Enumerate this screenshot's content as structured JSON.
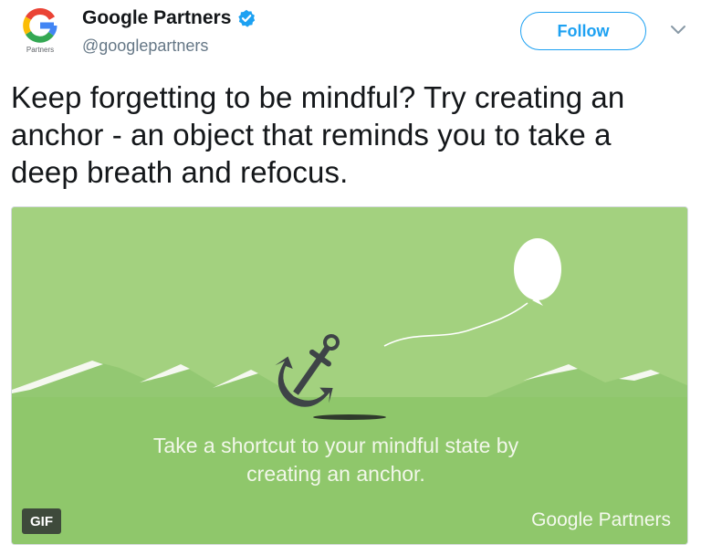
{
  "tweet": {
    "author": {
      "display_name": "Google Partners",
      "handle": "@googlepartners",
      "avatar_caption": "Partners",
      "verified_icon": "verified-badge-icon"
    },
    "follow_label": "Follow",
    "menu_icon": "chevron-down-icon",
    "text": "Keep forgetting to be mindful? Try creating an anchor - an object that reminds you to take a deep breath and refocus."
  },
  "media": {
    "type": "gif",
    "badge_label": "GIF",
    "caption": "Take a shortcut to your mindful state by creating an anchor.",
    "watermark": "Google Partners",
    "icons": [
      "balloon-icon",
      "anchor-icon"
    ]
  },
  "colors": {
    "accent": "#1da1f2",
    "sky_green": "#a3d17f",
    "ground_green": "#8fc76b",
    "mountain_green": "#93c872",
    "anchor": "#3e4347"
  }
}
